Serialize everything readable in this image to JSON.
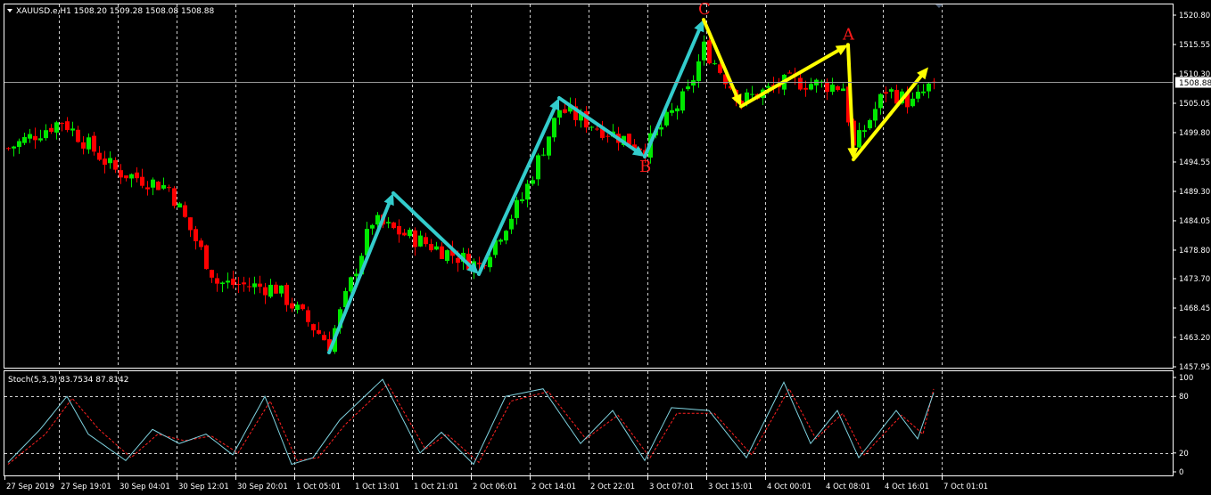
{
  "header": {
    "title": "XAUUSD.e,H1  1508.20 1509.28 1508.08 1508.88",
    "collapse_icon": "triangle-down-icon"
  },
  "indicator": {
    "title": "Stoch(5,3,3) 83.7534 87.8142",
    "levels": [
      80,
      20
    ],
    "scale_labels": [
      "100",
      "80",
      "20",
      "0"
    ]
  },
  "current_price_label": "1508.88",
  "colors": {
    "background": "#000000",
    "frame": "#ffffff",
    "bull": "#00e800",
    "bear": "#ff0000",
    "wave_arrow": "#33cccc",
    "correction_arrow": "#ffff00",
    "wave_label": "#ff1a1a",
    "stoch_main": "#7fd3e0",
    "stoch_signal": "#ff2020"
  },
  "chart_data": {
    "type": "candlestick",
    "symbol": "XAUUSD.e",
    "timeframe": "H1",
    "ylim": [
      1457.95,
      1520.8
    ],
    "y_ticks": [
      1520.8,
      1515.55,
      1510.3,
      1505.05,
      1499.8,
      1494.55,
      1489.3,
      1484.05,
      1478.8,
      1473.7,
      1468.45,
      1463.2,
      1457.95
    ],
    "x_labels": [
      "27 Sep 2019",
      "27 Sep 19:01",
      "30 Sep 04:01",
      "30 Sep 12:01",
      "30 Sep 20:01",
      "1 Oct 05:01",
      "1 Oct 13:01",
      "1 Oct 21:01",
      "2 Oct 06:01",
      "2 Oct 14:01",
      "2 Oct 22:01",
      "3 Oct 07:01",
      "3 Oct 15:01",
      "4 Oct 00:01",
      "4 Oct 08:01",
      "4 Oct 16:01",
      "7 Oct 01:01"
    ],
    "current_price": 1508.88,
    "wave_labels": [
      {
        "text": "C",
        "bar": 130,
        "price": 1521.0
      },
      {
        "text": "A",
        "bar": 157,
        "price": 1516.4
      },
      {
        "text": "B",
        "bar": 119,
        "price": 1492.8
      }
    ],
    "trend_arrows": [
      {
        "from_bar": 60,
        "from_price": 1460.5,
        "to_bar": 72,
        "to_price": 1489.0,
        "kind": "impulse"
      },
      {
        "from_bar": 72,
        "from_price": 1489.0,
        "to_bar": 88,
        "to_price": 1474.5,
        "kind": "impulse"
      },
      {
        "from_bar": 88,
        "from_price": 1474.5,
        "to_bar": 103,
        "to_price": 1506.0,
        "kind": "impulse"
      },
      {
        "from_bar": 103,
        "from_price": 1506.0,
        "to_bar": 119,
        "to_price": 1495.5,
        "kind": "impulse"
      },
      {
        "from_bar": 119,
        "from_price": 1495.5,
        "to_bar": 130,
        "to_price": 1520.0,
        "kind": "impulse"
      },
      {
        "from_bar": 130,
        "from_price": 1520.0,
        "to_bar": 137,
        "to_price": 1504.5,
        "kind": "correction"
      },
      {
        "from_bar": 137,
        "from_price": 1504.5,
        "to_bar": 157,
        "to_price": 1515.5,
        "kind": "correction"
      },
      {
        "from_bar": 157,
        "from_price": 1515.5,
        "to_bar": 158,
        "to_price": 1495.0,
        "kind": "correction"
      },
      {
        "from_bar": 158,
        "from_price": 1495.0,
        "to_bar": 172,
        "to_price": 1511.5,
        "kind": "correction"
      }
    ],
    "anchors": [
      {
        "bar": 0,
        "price": 1497.0
      },
      {
        "bar": 10,
        "price": 1502.0
      },
      {
        "bar": 20,
        "price": 1493.0
      },
      {
        "bar": 30,
        "price": 1490.0
      },
      {
        "bar": 39,
        "price": 1473.0
      },
      {
        "bar": 50,
        "price": 1472.0
      },
      {
        "bar": 60,
        "price": 1462.0
      },
      {
        "bar": 68,
        "price": 1484.0
      },
      {
        "bar": 78,
        "price": 1480.0
      },
      {
        "bar": 88,
        "price": 1476.0
      },
      {
        "bar": 96,
        "price": 1488.0
      },
      {
        "bar": 103,
        "price": 1504.0
      },
      {
        "bar": 112,
        "price": 1500.0
      },
      {
        "bar": 119,
        "price": 1497.0
      },
      {
        "bar": 127,
        "price": 1507.0
      },
      {
        "bar": 130,
        "price": 1515.0
      },
      {
        "bar": 137,
        "price": 1505.5
      },
      {
        "bar": 146,
        "price": 1509.0
      },
      {
        "bar": 156,
        "price": 1508.0
      },
      {
        "bar": 158,
        "price": 1497.0
      },
      {
        "bar": 164,
        "price": 1507.5
      },
      {
        "bar": 169,
        "price": 1505.0
      },
      {
        "bar": 173,
        "price": 1508.88
      }
    ],
    "stochastic": {
      "main": [
        {
          "bar": 0,
          "value": 10
        },
        {
          "bar": 6,
          "value": 45
        },
        {
          "bar": 11,
          "value": 80
        },
        {
          "bar": 15,
          "value": 40
        },
        {
          "bar": 22,
          "value": 12
        },
        {
          "bar": 27,
          "value": 45
        },
        {
          "bar": 32,
          "value": 30
        },
        {
          "bar": 37,
          "value": 40
        },
        {
          "bar": 42,
          "value": 18
        },
        {
          "bar": 48,
          "value": 80
        },
        {
          "bar": 53,
          "value": 8
        },
        {
          "bar": 57,
          "value": 15
        },
        {
          "bar": 62,
          "value": 55
        },
        {
          "bar": 70,
          "value": 98
        },
        {
          "bar": 77,
          "value": 20
        },
        {
          "bar": 81,
          "value": 42
        },
        {
          "bar": 87,
          "value": 8
        },
        {
          "bar": 93,
          "value": 80
        },
        {
          "bar": 100,
          "value": 88
        },
        {
          "bar": 107,
          "value": 30
        },
        {
          "bar": 113,
          "value": 65
        },
        {
          "bar": 119,
          "value": 12
        },
        {
          "bar": 124,
          "value": 68
        },
        {
          "bar": 131,
          "value": 65
        },
        {
          "bar": 138,
          "value": 15
        },
        {
          "bar": 145,
          "value": 95
        },
        {
          "bar": 150,
          "value": 30
        },
        {
          "bar": 155,
          "value": 65
        },
        {
          "bar": 159,
          "value": 15
        },
        {
          "bar": 166,
          "value": 65
        },
        {
          "bar": 170,
          "value": 35
        },
        {
          "bar": 173,
          "value": 83.75
        }
      ],
      "signal": [
        {
          "bar": 0,
          "value": 8
        },
        {
          "bar": 7,
          "value": 40
        },
        {
          "bar": 12,
          "value": 78
        },
        {
          "bar": 17,
          "value": 45
        },
        {
          "bar": 23,
          "value": 15
        },
        {
          "bar": 28,
          "value": 40
        },
        {
          "bar": 33,
          "value": 33
        },
        {
          "bar": 38,
          "value": 38
        },
        {
          "bar": 43,
          "value": 20
        },
        {
          "bar": 49,
          "value": 75
        },
        {
          "bar": 54,
          "value": 12
        },
        {
          "bar": 58,
          "value": 15
        },
        {
          "bar": 63,
          "value": 50
        },
        {
          "bar": 71,
          "value": 93
        },
        {
          "bar": 78,
          "value": 24
        },
        {
          "bar": 82,
          "value": 40
        },
        {
          "bar": 88,
          "value": 10
        },
        {
          "bar": 94,
          "value": 75
        },
        {
          "bar": 101,
          "value": 85
        },
        {
          "bar": 108,
          "value": 35
        },
        {
          "bar": 114,
          "value": 60
        },
        {
          "bar": 120,
          "value": 15
        },
        {
          "bar": 125,
          "value": 62
        },
        {
          "bar": 132,
          "value": 62
        },
        {
          "bar": 139,
          "value": 18
        },
        {
          "bar": 146,
          "value": 88
        },
        {
          "bar": 151,
          "value": 35
        },
        {
          "bar": 156,
          "value": 62
        },
        {
          "bar": 160,
          "value": 18
        },
        {
          "bar": 167,
          "value": 60
        },
        {
          "bar": 171,
          "value": 40
        },
        {
          "bar": 173,
          "value": 87.81
        }
      ]
    }
  }
}
